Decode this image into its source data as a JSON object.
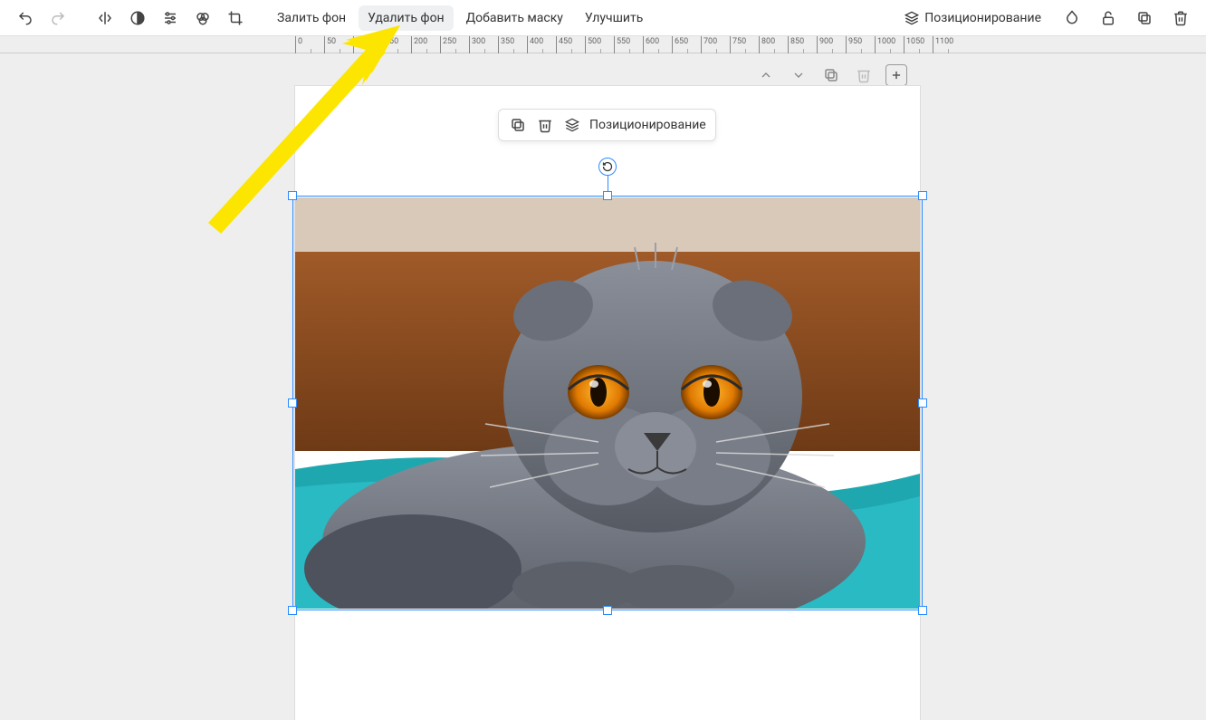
{
  "toolbar": {
    "text_buttons": {
      "fill_bg": "Залить фон",
      "remove_bg": "Удалить фон",
      "add_mask": "Добавить маску",
      "enhance": "Улучшить"
    },
    "positioning": "Позиционирование"
  },
  "floating": {
    "positioning": "Позиционирование"
  },
  "ruler": {
    "ticks": [
      "0",
      "50",
      "100",
      "150",
      "200",
      "250",
      "300",
      "350",
      "400",
      "450",
      "500",
      "550",
      "600",
      "650",
      "700",
      "750",
      "800",
      "850",
      "900",
      "950",
      "1000",
      "1050",
      "1100"
    ]
  },
  "image": {
    "description": "Серый вислоухий кот с оранжевыми глазами на бирюзовом покрывале"
  },
  "annotation": {
    "color": "#fce500"
  }
}
